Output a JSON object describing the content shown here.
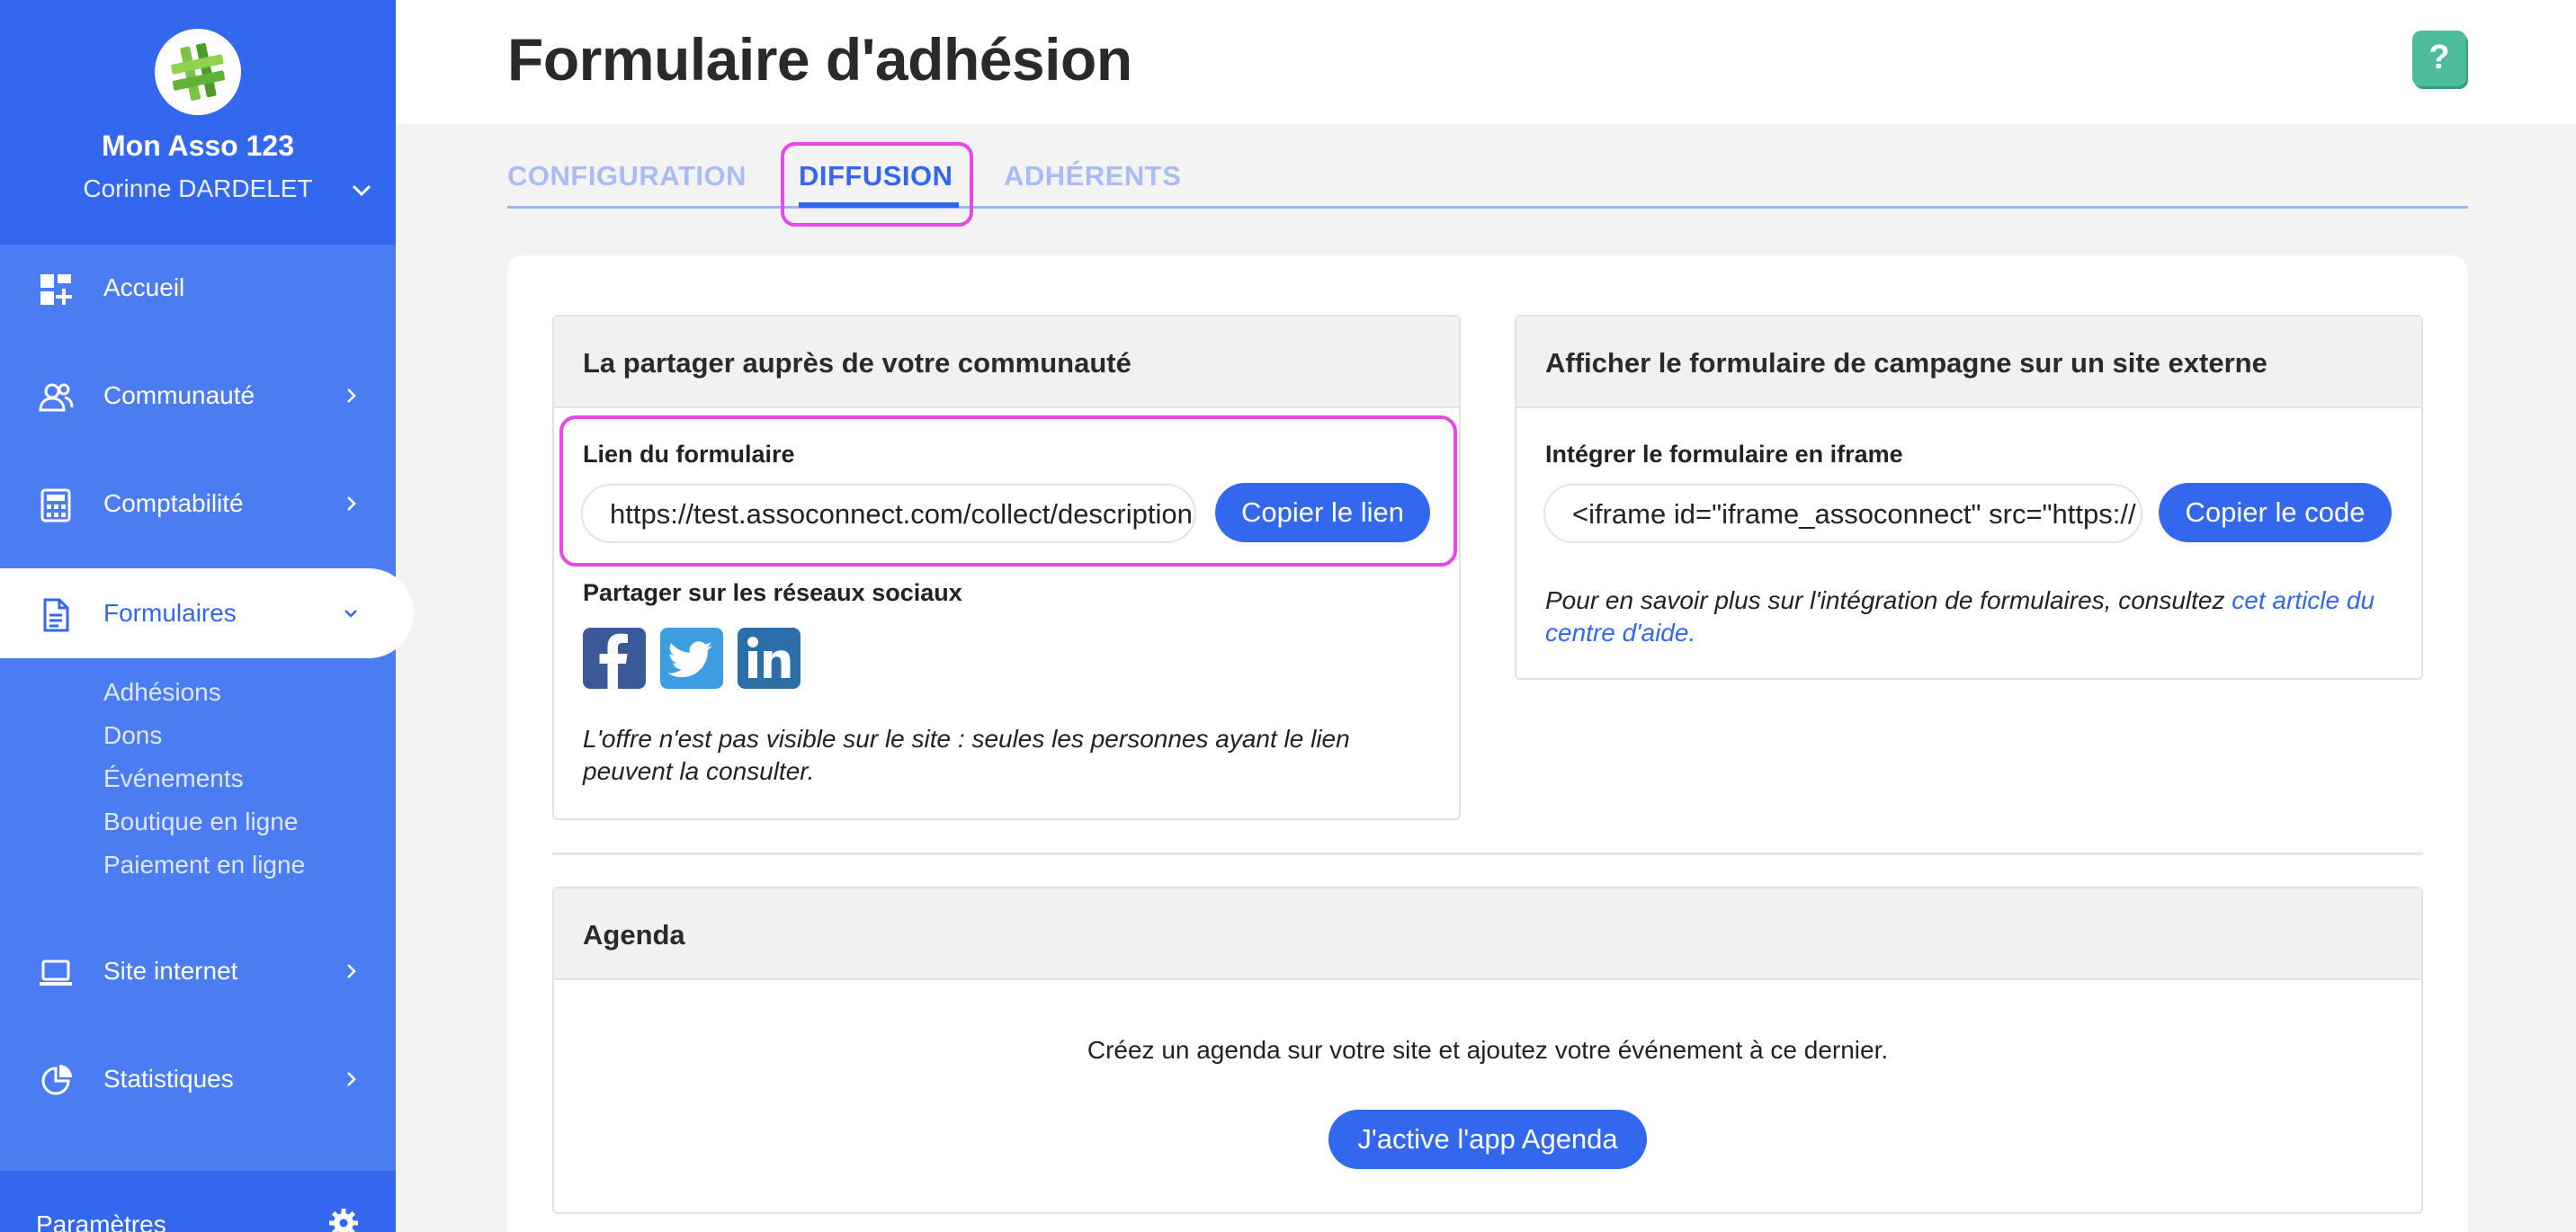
{
  "sidebar": {
    "org_name": "Mon Asso 123",
    "user_name": "Corinne DARDELET",
    "items": [
      {
        "label": "Accueil",
        "icon": "dashboard-icon"
      },
      {
        "label": "Communauté",
        "icon": "users-icon"
      },
      {
        "label": "Comptabilité",
        "icon": "calculator-icon"
      },
      {
        "label": "Formulaires",
        "icon": "document-icon"
      },
      {
        "label": "Site internet",
        "icon": "laptop-icon"
      },
      {
        "label": "Statistiques",
        "icon": "pie-chart-icon"
      }
    ],
    "subitems": [
      "Adhésions",
      "Dons",
      "Événements",
      "Boutique en ligne",
      "Paiement en ligne"
    ],
    "footer_label": "Paramètres"
  },
  "header": {
    "title": "Formulaire d'adhésion",
    "help_label": "?"
  },
  "tabs": [
    "CONFIGURATION",
    "DIFFUSION",
    "ADHÉRENTS"
  ],
  "share_panel": {
    "title": "La partager auprès de votre communauté",
    "link_label": "Lien du formulaire",
    "link_value": "https://test.assoconnect.com/collect/description/",
    "copy_link_button": "Copier le lien",
    "social_label": "Partager sur les réseaux sociaux",
    "notice": "L'offre n'est pas visible sur le site : seules les personnes ayant le lien peuvent la consulter."
  },
  "embed_panel": {
    "title": "Afficher le formulaire de campagne sur un site externe",
    "iframe_label": "Intégrer le formulaire en iframe",
    "iframe_value": "<iframe id=\"iframe_assoconnect\" src=\"https://",
    "copy_code_button": "Copier le code",
    "help_text": "Pour en savoir plus sur l'intégration de formulaires, consultez ",
    "help_link": "cet article du centre d'aide."
  },
  "agenda_panel": {
    "title": "Agenda",
    "description": "Créez un agenda sur votre site et ajoutez votre événement à ce dernier.",
    "button": "J'active l'app Agenda"
  },
  "colors": {
    "sidebar": "#4b7cf1",
    "sidebar_header": "#3367ee",
    "accent": "#3367ee",
    "highlight": "#e64ae6",
    "help": "#4dbc9a"
  }
}
